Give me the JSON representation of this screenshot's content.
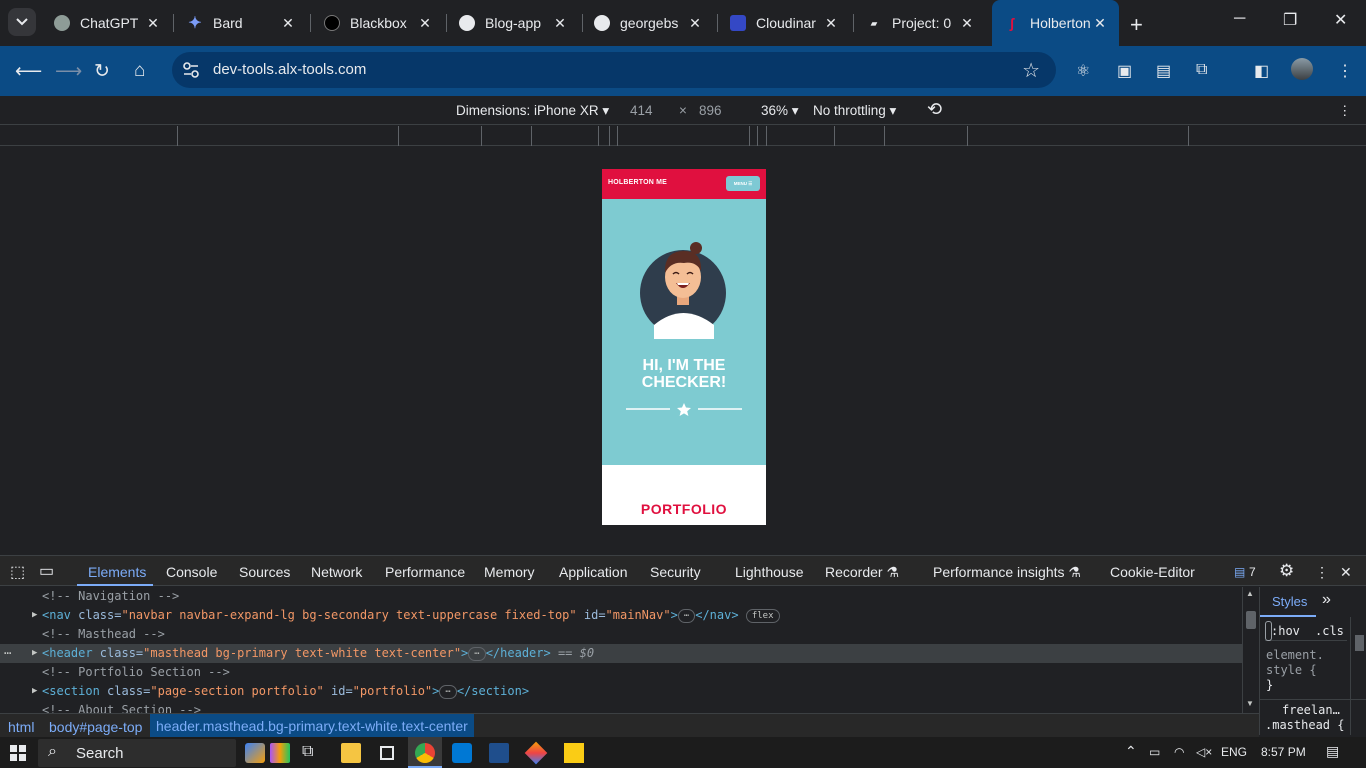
{
  "tabs": [
    {
      "title": "ChatGPT",
      "icon": "chatgpt-icon"
    },
    {
      "title": "Bard",
      "icon": "bard-icon"
    },
    {
      "title": "Blackbox",
      "icon": "blackbox-icon"
    },
    {
      "title": "Blog-app",
      "icon": "github-icon"
    },
    {
      "title": "georgebs",
      "icon": "github-icon"
    },
    {
      "title": "Cloudinar",
      "icon": "cloudinary-icon"
    },
    {
      "title": "Project: 0",
      "icon": "alx-icon"
    },
    {
      "title": "Holberton",
      "icon": "holberton-icon"
    }
  ],
  "toolbar": {
    "url": "dev-tools.alx-tools.com"
  },
  "device_bar": {
    "dimensions": "Dimensions: iPhone XR",
    "width": "414",
    "times": "×",
    "height": "896",
    "zoom": "36%",
    "throttling": "No throttling"
  },
  "page": {
    "brand": "HOLBERTON ME",
    "menu": "MENU ☰",
    "title": "HI, I'M THE CHECKER!",
    "portfolio": "PORTFOLIO"
  },
  "devtools": {
    "tabs": [
      "Elements",
      "Console",
      "Sources",
      "Network",
      "Performance",
      "Memory",
      "Application",
      "Security",
      "Lighthouse",
      "Recorder",
      "Performance insights",
      "Cookie-Editor"
    ],
    "message_count": "7",
    "styles_tab": "Styles",
    "hov": ":hov",
    "cls": ".cls",
    "element_style_1": "element.",
    "element_style_2": "style {",
    "element_style_3": "}",
    "style_rule_1": "freelan…",
    "style_rule_2": ".masthead {"
  },
  "dom": {
    "c_nav": "<!-- Navigation -->",
    "nav_tag": "<nav",
    "nav_class_attr": " class=",
    "nav_class_val": "\"navbar navbar-expand-lg bg-secondary text-uppercase fixed-top\"",
    "nav_id_attr": " id=",
    "nav_id_val": "\"mainNav\"",
    "nav_close": "</nav>",
    "nav_badge": "flex",
    "c_mast": "<!-- Masthead -->",
    "header_tag": "<header",
    "header_class_attr": " class=",
    "header_class_val": "\"masthead bg-primary text-white text-center\"",
    "header_close": "</header>",
    "header_eq": " == $0",
    "c_port": "<!-- Portfolio Section -->",
    "section_tag": "<section",
    "section_class_attr": " class=",
    "section_class_val": "\"page-section portfolio\"",
    "section_id_attr": " id=",
    "section_id_val": "\"portfolio\"",
    "section_close": "</section>",
    "c_about": "<!-- About Section -->",
    "gt": ">",
    "ellipsis": "⋯"
  },
  "breadcrumb": [
    "html",
    "body#page-top",
    "header.masthead.bg-primary.text-white.text-center"
  ],
  "taskbar": {
    "search": "Search",
    "lang": "ENG",
    "time": "8:57 PM"
  }
}
